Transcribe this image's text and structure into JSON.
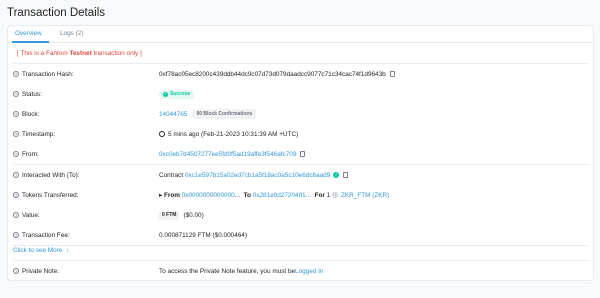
{
  "header": {
    "title": "Transaction Details"
  },
  "tabs": [
    {
      "label": "Overview"
    },
    {
      "label": "Logs (2)"
    }
  ],
  "notice": {
    "prefix": "[ This is a Fantom ",
    "network": "Testnet",
    "suffix": " transaction only ]"
  },
  "rows": {
    "hash": {
      "label": "Transaction Hash:",
      "value": "0xf78ac05ec8200c439ddb44dc9c07d73d079daadcc9077c71c34cac74f1d9643b"
    },
    "status": {
      "label": "Status:",
      "value": "Success"
    },
    "block": {
      "label": "Block:",
      "value": "14044765",
      "confirmations": "90 Block Confirmations"
    },
    "timestamp": {
      "label": "Timestamp:",
      "value": "5 mins ago (Feb-21-2023 10:31:39 AM +UTC)"
    },
    "from": {
      "label": "From:",
      "value": "0xc0eb7d4507277ee5fd0f5ad19affe3f546afc709"
    },
    "interacted": {
      "label": "Interacted With (To):",
      "prefix": "Contract",
      "value": "0xc1e597b15a02ed7cb1a5f18ac0a5c10e6dc6aad9"
    },
    "tokens": {
      "label": "Tokens Transferred:",
      "from_label": "From",
      "from_value": "0x0000000000000...",
      "to_label": "To",
      "to_value": "0x281e0d2720491...",
      "for_label": "For",
      "amount": "1",
      "token": "ZKR_FTM (ZKR)"
    },
    "value": {
      "label": "Value:",
      "amount": "0 FTM",
      "usd": "($0.00)"
    },
    "fee": {
      "label": "Transaction Fee:",
      "value": "0.000871129 FTM ($0.000464)"
    }
  },
  "more": {
    "label": "Click to see More"
  },
  "private_note": {
    "label": "Private Note:",
    "text": "To access the Private Note feature, you must be ",
    "link": "Logged In"
  },
  "colors": {
    "accent": "#3498db",
    "success": "#00c9a7",
    "danger": "#de4437"
  }
}
